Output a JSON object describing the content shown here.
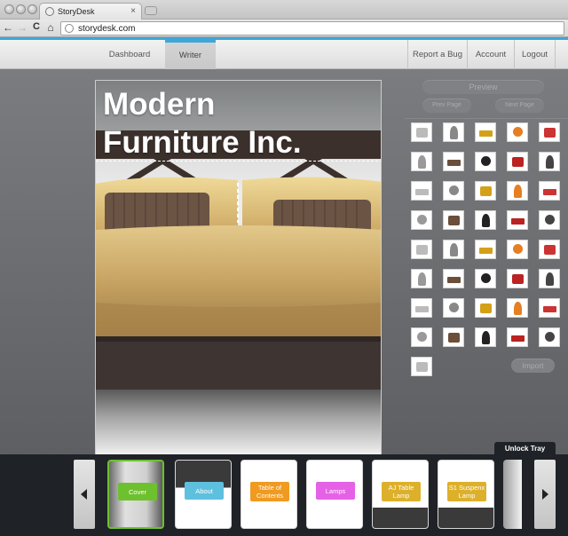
{
  "browser": {
    "tab_title": "StoryDesk",
    "tab_close": "×",
    "url": "storydesk.com",
    "back": "←",
    "forward": "→",
    "reload": "C",
    "home": "⌂"
  },
  "nav": {
    "dashboard": "Dashboard",
    "writer": "Writer",
    "report_bug": "Report a Bug",
    "account": "Account",
    "logout": "Logout"
  },
  "page": {
    "headline_line1": "Modern",
    "headline_line2": "Furniture Inc."
  },
  "panel": {
    "preview": "Preview",
    "prev_page": "Prev Page",
    "next_page": "Next Page",
    "import": "Import",
    "thumbnail_count": 41
  },
  "tray": {
    "unlock_label": "Unlock Tray",
    "cards": [
      {
        "label": "Cover",
        "color": "#6ec12e"
      },
      {
        "label": "About",
        "color": "#5ec0df"
      },
      {
        "label": "Table of Contents",
        "color": "#f09a20"
      },
      {
        "label": "Lamps",
        "color": "#e561e6"
      },
      {
        "label": "AJ Table Lamp",
        "color": "#ddb02b"
      },
      {
        "label": "S1 Suspenx Lamp",
        "color": "#ddb02b"
      }
    ]
  },
  "colors": {
    "accent": "#3fa7d6",
    "tray_bg": "#1f2328"
  }
}
